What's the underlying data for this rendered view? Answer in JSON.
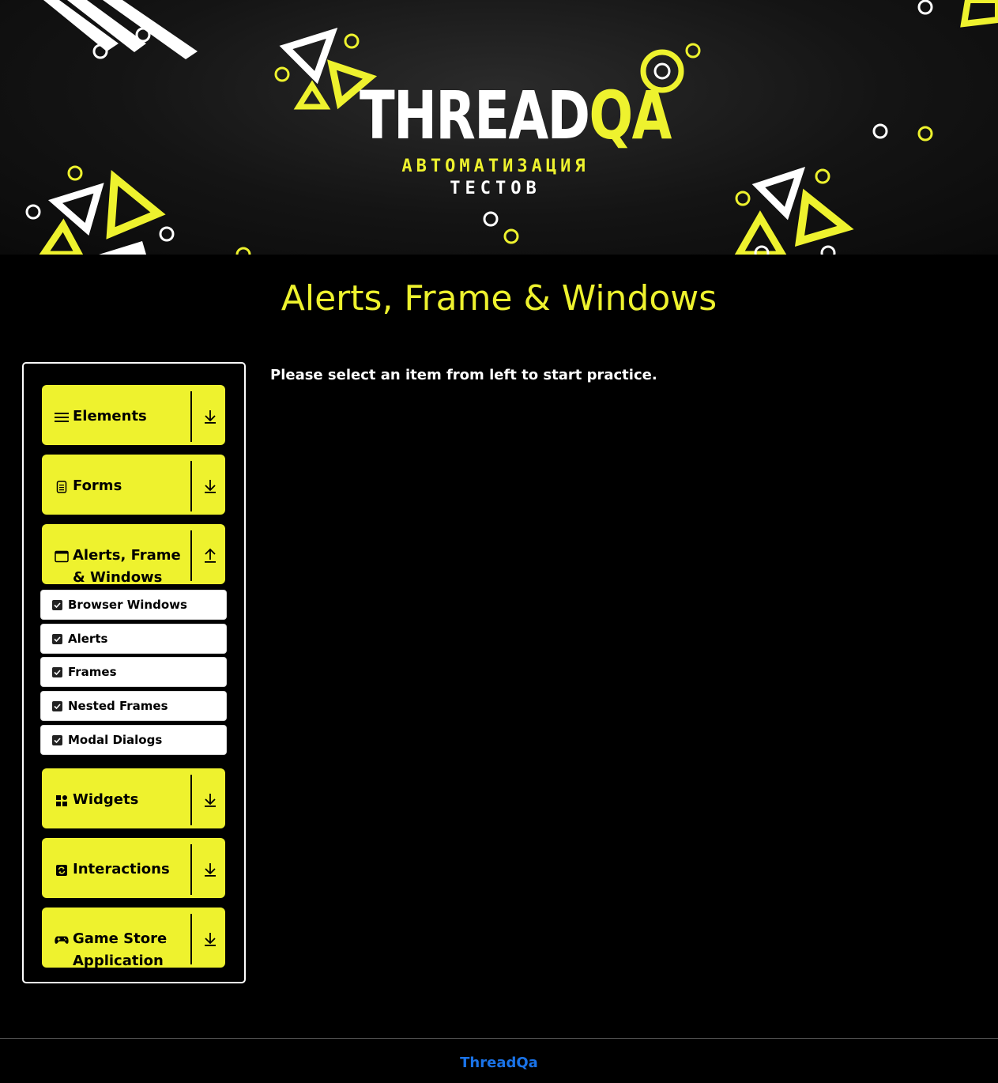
{
  "banner": {
    "logo_white": "THREAD",
    "logo_yellow": "QA",
    "subtitle_line1": "АВТОМАТИЗАЦИЯ",
    "subtitle_line2": "ТЕСТОВ"
  },
  "page": {
    "title": "Alerts, Frame & Windows"
  },
  "main": {
    "message": "Please select an item from left to start practice."
  },
  "sidebar": {
    "groups": [
      {
        "label": "Elements",
        "icon": "hamburger-icon",
        "expanded": false
      },
      {
        "label": "Forms",
        "icon": "document-icon",
        "expanded": false
      },
      {
        "label": "Alerts, Frame & Windows",
        "icon": "window-icon",
        "expanded": true,
        "items": [
          "Browser Windows",
          "Alerts",
          "Frames",
          "Nested Frames",
          "Modal Dialogs"
        ]
      },
      {
        "label": "Widgets",
        "icon": "grid-icon",
        "expanded": false
      },
      {
        "label": "Interactions",
        "icon": "repeat-icon",
        "expanded": false
      },
      {
        "label": "Game Store Application",
        "icon": "gamepad-icon",
        "expanded": false
      }
    ]
  },
  "footer": {
    "link_text": "ThreadQa"
  },
  "colors": {
    "accent": "#eef22e",
    "background": "#000000",
    "link": "#1a73e8"
  }
}
